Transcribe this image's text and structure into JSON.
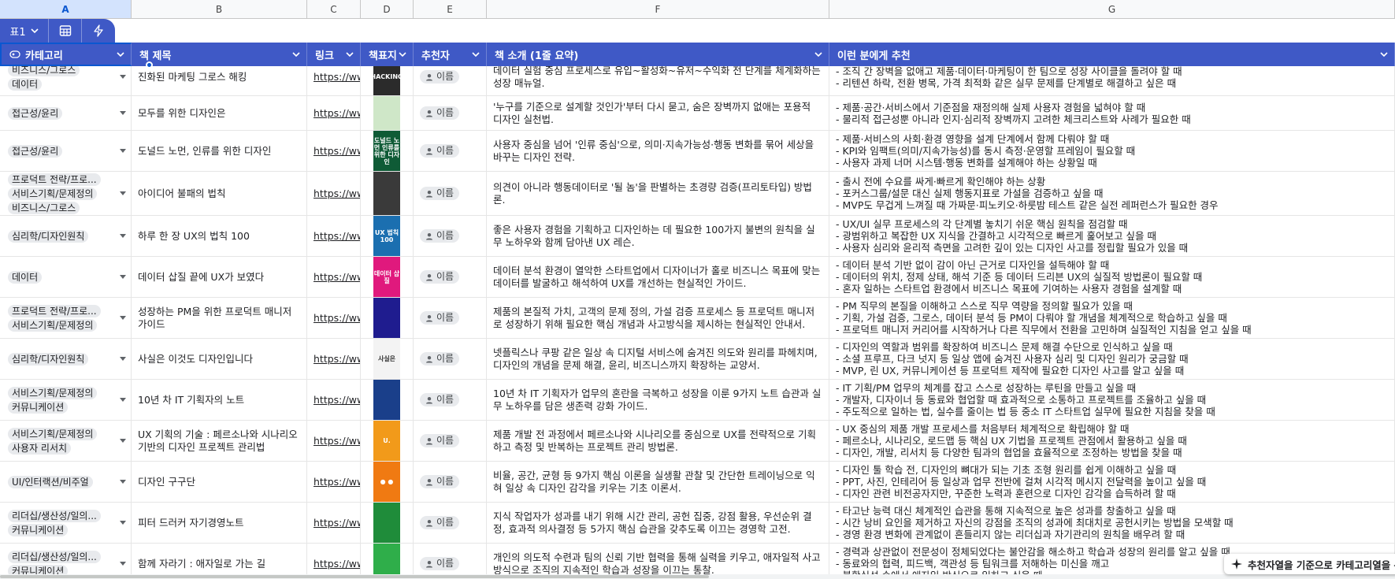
{
  "columns": [
    "A",
    "B",
    "C",
    "D",
    "E",
    "F",
    "G"
  ],
  "toolbar": {
    "table_name": "표1",
    "grid_icon": "grid-icon",
    "bolt_icon": "lightning-icon"
  },
  "headers": {
    "category": "카테고리",
    "title": "책 제목",
    "link": "링크",
    "cover": "책표지",
    "recommender": "추천자",
    "intro": "책 소개 (1줄 요약)",
    "for_whom": "이런 분에게 추천"
  },
  "rows": [
    {
      "categories": [
        "비즈니스/그로스",
        "데이터"
      ],
      "title": "진화된 마케팅 그로스 해킹",
      "link": "https://www",
      "recommender": "이름",
      "intro": "데이터 실험 중심 프로세스로 유입~활성화~유저~수익화 전 단계를 체계화하는 성장 매뉴얼.",
      "for_whom": [
        "- 조직 간 장벽을 없애고 제품·데이터·마케팅이 한 팀으로 성장 사이클을 돌려야 할 때",
        "- 리텐션 하락, 전환 병목, 가격 최적화 같은 실무 문제를 단계별로 해결하고 싶은 때"
      ]
    },
    {
      "categories": [
        "접근성/윤리"
      ],
      "title": "모두를 위한 디자인은",
      "link": "https://www",
      "recommender": "이름",
      "intro": "'누구를 기준으로 설계할 것인가'부터 다시 묻고, 숨은 장벽까지 없애는 포용적 디자인 실천법.",
      "for_whom": [
        "- 제품·공간·서비스에서 기준점을 재정의해 실제 사용자 경험을 넓혀야 할 때",
        "- 물리적 접근성뿐 아니라 인지·심리적 장벽까지 고려한 체크리스트와 사례가 필요한 때"
      ]
    },
    {
      "categories": [
        "접근성/윤리"
      ],
      "title": "도널드 노먼, 인류를 위한 디자인",
      "link": "https://www",
      "recommender": "이름",
      "intro": "사용자 중심을 넘어 '인류 중심'으로, 의미·지속가능성·행동 변화를 묶어 세상을 바꾸는 디자인 전략.",
      "for_whom": [
        "- 제품·서비스의 사회·환경 영향을 설계 단계에서 함께 다뤄야 할 때",
        "- KPI와 임팩트(의미/지속가능성)를 동시 측정·운영할 프레임이 필요할 때",
        "- 사용자 과제 너머 시스템·행동 변화를 설계해야 하는 상황일 때"
      ]
    },
    {
      "categories": [
        "프로덕트 전략/프로...",
        "서비스기획/문제정의",
        "비즈니스/그로스"
      ],
      "title": "아이디어 불패의 법칙",
      "link": "https://www",
      "recommender": "이름",
      "intro": "의견이 아니라 행동데이터로 '될 놈'을 판별하는 초경량 검증(프리토타입) 방법론.",
      "for_whom": [
        "- 출시 전에 수요를 싸게·빠르게 확인해야 하는 상황",
        "- 포커스그룹/설문 대신 실제 행동지표로 가설을 검증하고 싶을 때",
        "- MVP도 무겁게 느껴질 때 가짜문·피노키오·하룻밤 테스트 같은 실전 레퍼런스가 필요한 경우"
      ]
    },
    {
      "categories": [
        "심리학/디자인원칙"
      ],
      "title": "하루 한 장 UX의 법칙 100",
      "link": "https://www",
      "recommender": "이름",
      "intro": "좋은 사용자 경험을 기획하고 디자인하는 데 필요한 100가지 불변의 원칙을 실무 노하우와 함께 담아낸 UX 레슨.",
      "for_whom": [
        "- UX/UI 실무 프로세스의 각 단계별 놓치기 쉬운 핵심 원칙을 점검할 때",
        "- 광범위하고 복잡한 UX 지식을 간결하고 시각적으로 빠르게 훑어보고 싶을 때",
        "- 사용자 심리와 윤리적 측면을 고려한 깊이 있는 디자인 사고를 정립할 필요가 있을 때"
      ]
    },
    {
      "categories": [
        "데이터"
      ],
      "title": "데이터 삽질 끝에 UX가 보였다",
      "link": "https://www",
      "recommender": "이름",
      "intro": "데이터 분석 환경이 열악한 스타트업에서 디자이너가 홀로 비즈니스 목표에 맞는 데이터를 발굴하고 해석하여 UX를 개선하는 현실적인 가이드.",
      "for_whom": [
        "- 데이터 분석 기반 없이 감이 아닌 근거로 디자인을 설득해야 할 때",
        "- 데이터의 위치, 정제 상태, 해석 기준 등 데이터 드리븐 UX의 실질적 방법론이 필요할 때",
        "- 혼자 일하는 스타트업 환경에서 비즈니스 목표에 기여하는 사용자 경험을 설계할 때"
      ]
    },
    {
      "categories": [
        "프로덕트 전략/프로...",
        "서비스기획/문제정의"
      ],
      "title": "성장하는 PM을 위한 프로덕트 매니저 가이드",
      "link": "https://www",
      "recommender": "이름",
      "intro": "제품의 본질적 가치, 고객의 문제 정의, 가설 검증 프로세스 등 프로덕트 매니저로 성장하기 위해 필요한 핵심 개념과 사고방식을 제시하는 현실적인 안내서.",
      "for_whom": [
        "- PM 직무의 본질을 이해하고 스스로 직무 역량을 정의할 필요가 있을 때",
        "- 기획, 가설 검증, 그로스, 데이터 분석 등 PM이 다뤄야 할 개념을 체계적으로 학습하고 싶을 때",
        "- 프로덕트 매니저 커리어를 시작하거나 다른 직무에서 전환을 고민하며 실질적인 지침을 얻고 싶을 때"
      ]
    },
    {
      "categories": [
        "심리학/디자인원칙"
      ],
      "title": "사실은 이것도 디자인입니다",
      "link": "https://www",
      "recommender": "이름",
      "intro": "넷플릭스나 쿠팡 같은 일상 속 디지털 서비스에 숨겨진 의도와 원리를 파헤치며, 디자인의 개념을 문제 해결, 윤리, 비즈니스까지 확장하는 교양서.",
      "for_whom": [
        "- 디자인의 역할과 범위를 확장하여 비즈니스 문제 해결 수단으로 인식하고 싶을 때",
        "- 소셜 프루프, 다크 넛지 등 일상 앱에 숨겨진 사용자 심리 및 디자인 원리가 궁금할 때",
        "- MVP, 린 UX, 커뮤니케이션 등 프로덕트 제작에 필요한 디자인 사고를 알고 싶을 때"
      ]
    },
    {
      "categories": [
        "서비스기획/문제정의",
        "커뮤니케이션"
      ],
      "title": "10년 차 IT 기획자의 노트",
      "link": "https://www",
      "recommender": "이름",
      "intro": "10년 차 IT 기획자가 업무의 혼란을 극복하고 성장을 이룬 9가지 노트 습관과 실무 노하우를 담은 생존력 강화 가이드.",
      "for_whom": [
        "- IT 기획/PM 업무의 체계를 잡고 스스로 성장하는 루틴을 만들고 싶을 때",
        "- 개발자, 디자이너 등 동료와 협업할 때 효과적으로 소통하고 프로젝트를 조율하고 싶을 때",
        "- 주도적으로 일하는 법, 실수를 줄이는 법 등 중소 IT 스타트업 실무에 필요한 지침을 찾을 때"
      ]
    },
    {
      "categories": [
        "서비스기획/문제정의",
        "사용자 리서치"
      ],
      "title": "UX 기획의 기술 : 페르소나와 시나리오 기반의 디자인 프로젝트 관리법",
      "link": "https://www",
      "recommender": "이름",
      "intro": "제품 개발 전 과정에서 페르소나와 시나리오를 중심으로 UX를 전략적으로 기획하고 측정 및 반복하는 프로젝트 관리 방법론.",
      "for_whom": [
        "- UX 중심의 제품 개발 프로세스를 처음부터 체계적으로 확립해야 할 때",
        "- 페르소나, 시나리오, 로드맵 등 핵심 UX 기법을 프로젝트 관점에서 활용하고 싶을 때",
        "- 디자인, 개발, 리서치 등 다양한 팀과의 협업을 효율적으로 조정하는 방법을 찾을 때"
      ]
    },
    {
      "categories": [
        "UI/인터랙션/비주얼"
      ],
      "title": "디자인 구구단",
      "link": "https://www",
      "recommender": "이름",
      "intro": "비율, 공간, 균형 등 9가지 핵심 이론을 실생활 관찰 및 간단한 트레이닝으로 익혀 일상 속 디자인 감각을 키우는 기초 이론서.",
      "for_whom": [
        "- 디자인 툴 학습 전, 디자인의 뼈대가 되는 기초 조형 원리를 쉽게 이해하고 싶을 때",
        "- PPT, 사진, 인테리어 등 일상과 업무 전반에 걸쳐 시각적 메시지 전달력을 높이고 싶을 때",
        "- 디자인 관련 비전공자지만, 꾸준한 노력과 훈련으로 디자인 감각을 습득하려 할 때"
      ]
    },
    {
      "categories": [
        "리더십/생산성/일의...",
        "커뮤니케이션"
      ],
      "title": "피터 드러커 자기경영노트",
      "link": "https://www",
      "recommender": "이름",
      "intro": "지식 작업자가 성과를 내기 위해 시간 관리, 공헌 집중, 강점 활용, 우선순위 결정, 효과적 의사결정 등 5가지 핵심 습관을 갖추도록 이끄는 경영학 고전.",
      "for_whom": [
        "- 타고난 능력 대신 체계적인 습관을 통해 지속적으로 높은 성과를 창출하고 싶을 때",
        "- 시간 낭비 요인을 제거하고 자신의 강점을 조직의 성과에 최대치로 공헌시키는 방법을 모색할 때",
        "- 경영 환경 변화에 관계없이 흔들리지 않는 리더십과 자기관리의 원칙을 배우려 할 때"
      ]
    },
    {
      "categories": [
        "리더십/생산성/일의...",
        "커뮤니케이션"
      ],
      "title": "함께 자라기 : 애자일로 가는 길",
      "link": "https://www",
      "recommender": "이름",
      "intro": "개인의 의도적 수련과 팀의 신뢰 기반 협력을 통해 실력을 키우고, 애자일적 사고방식으로 조직의 지속적인 학습과 성장을 이끄는 통찰.",
      "for_whom": [
        "- 경력과 상관없이 전문성이 정체되었다는 불안감을 해소하고 학습과 성장의 원리를 알고 싶을 때",
        "- 동료와의 협력, 피드백, 객관성 등 팀워크를 저해하는 미신을 깨고",
        "- 불확실성 속에서 애자일 방식으로 일하고 싶을 때"
      ]
    }
  ],
  "covers": [
    {
      "text": "HACKING",
      "color": "#2b2b2b"
    },
    {
      "text": "",
      "color": "#cfe7c8"
    },
    {
      "text": "도널드 노먼 인류를 위한 디자인",
      "color": "#0f5b36"
    },
    {
      "text": "",
      "color": "#3a3a3a"
    },
    {
      "text": "UX 법칙 100",
      "color": "#1b6fb0"
    },
    {
      "text": "데이터 삽질",
      "color": "#e0197d"
    },
    {
      "text": "",
      "color": "#1f1c8f"
    },
    {
      "text": "사실은",
      "color": "#f3f3f3"
    },
    {
      "text": "",
      "color": "#1a3f8a"
    },
    {
      "text": "U.",
      "color": "#f29a1a"
    },
    {
      "text": "● ●",
      "color": "#f07a12"
    },
    {
      "text": "",
      "color": "#1f8c3a"
    },
    {
      "text": "",
      "color": "#2fae4a"
    }
  ],
  "toast": {
    "text": "추천자열을 기준으로 카테고리열을 분",
    "icon": "sparkle-icon"
  },
  "colors": {
    "header_bg": "#3f59c6",
    "chip_bg": "#e8eaed",
    "selection": "#0b57d0"
  }
}
